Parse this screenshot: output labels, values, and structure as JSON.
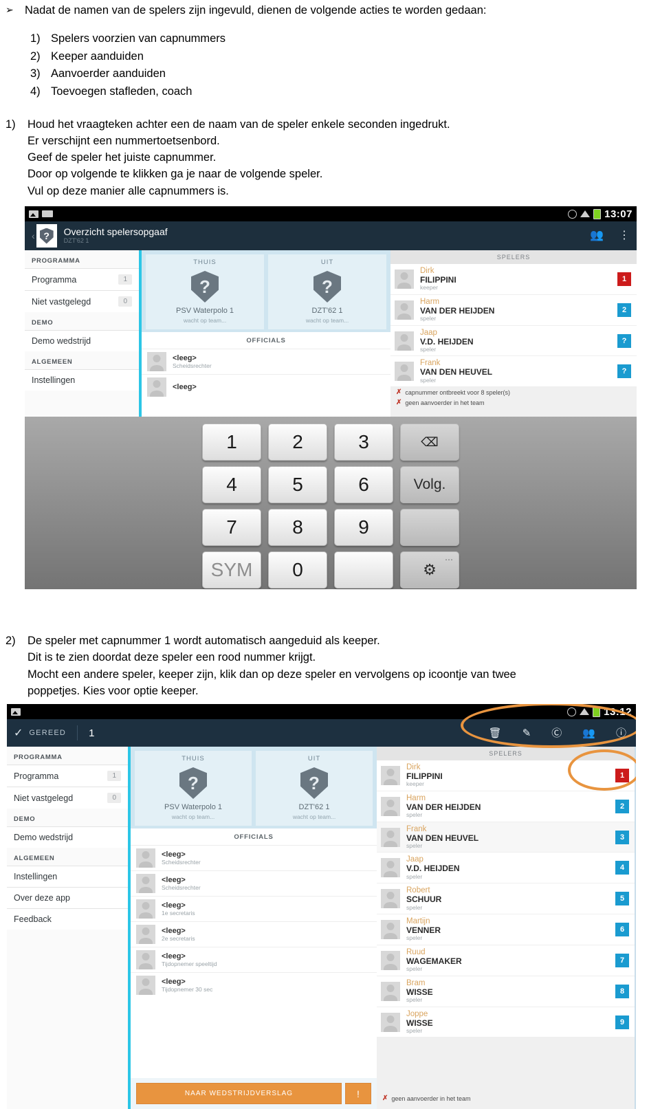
{
  "document": {
    "bullet_marker": "➢",
    "intro": "Nadat de namen van de spelers zijn ingevuld, dienen de volgende acties te worden gedaan:",
    "actions": [
      {
        "num": "1)",
        "text": "Spelers voorzien van capnummers"
      },
      {
        "num": "2)",
        "text": " Keeper aanduiden"
      },
      {
        "num": "3)",
        "text": "Aanvoerder aanduiden"
      },
      {
        "num": "4)",
        "text": "Toevoegen stafleden, coach"
      }
    ],
    "step1": {
      "num": "1)",
      "lines": [
        "Houd het vraagteken achter een de naam van de speler enkele seconden ingedrukt.",
        "Er verschijnt een nummertoetsenbord.",
        "Geef de speler het juiste capnummer.",
        "Door op volgende te klikken ga je naar de volgende speler.",
        "Vul op deze manier alle capnummers is."
      ]
    },
    "step2": {
      "num": "2)",
      "lines": [
        "De speler met capnummer 1 wordt automatisch aangeduid als keeper.",
        "Dit is te zien doordat deze speler een rood nummer krijgt.",
        "Mocht een andere speler, keeper zijn, klik dan op deze speler en vervolgens op icoontje van twee",
        "poppetjes. Kies voor optie keeper."
      ]
    }
  },
  "screenshot1": {
    "statusbar": {
      "time": "13:07",
      "icons": [
        "image-icon",
        "keyboard-icon",
        "alarm-icon",
        "wifi-icon",
        "battery-icon"
      ]
    },
    "appbar": {
      "back": "‹",
      "shield_glyph": "?",
      "title": "Overzicht spelersopgaaf",
      "subtitle": "DZT'62 1",
      "icons": [
        "add-people-icon",
        "overflow-menu-icon"
      ],
      "add_people_glyph": "👥",
      "overflow_glyph": "⋮"
    },
    "nav": {
      "groups": [
        {
          "header": "PROGRAMMA",
          "items": [
            {
              "label": "Programma",
              "badge": "1"
            },
            {
              "label": "Niet vastgelegd",
              "badge": "0"
            }
          ]
        },
        {
          "header": "DEMO",
          "items": [
            {
              "label": "Demo wedstrijd",
              "badge": ""
            }
          ]
        },
        {
          "header": "ALGEMEEN",
          "items": [
            {
              "label": "Instellingen",
              "badge": ""
            }
          ]
        }
      ]
    },
    "teams": [
      {
        "side": "THUIS",
        "shield": "?",
        "name": "PSV Waterpolo 1",
        "status": "wacht op team..."
      },
      {
        "side": "UIT",
        "shield": "?",
        "name": "DZT'62 1",
        "status": "wacht op team..."
      }
    ],
    "officials": {
      "header": "OFFICIALS",
      "rows": [
        {
          "name": "<leeg>",
          "role": "Scheidsrechter"
        },
        {
          "name": "<leeg>",
          "role": ""
        }
      ]
    },
    "players": {
      "header": "SPELERS",
      "rows": [
        {
          "first": "Dirk",
          "last": "FILIPPINI",
          "role": "keeper",
          "cap": "1",
          "cap_color": "red"
        },
        {
          "first": "Harm",
          "last": "VAN DER HEIJDEN",
          "role": "speler",
          "cap": "2",
          "cap_color": "blue"
        },
        {
          "first": "Jaap",
          "last": "V.D. HEIJDEN",
          "role": "speler",
          "cap": "?",
          "cap_color": "blue"
        },
        {
          "first": "Frank",
          "last": "VAN DEN HEUVEL",
          "role": "speler",
          "cap": "?",
          "cap_color": "blue"
        }
      ],
      "errors": [
        "capnummer ontbreekt voor 8 speler(s)",
        "geen aanvoerder in het team"
      ]
    },
    "keyboard": {
      "rows": [
        [
          {
            "label": "1",
            "type": "num"
          },
          {
            "label": "2",
            "type": "num"
          },
          {
            "label": "3",
            "type": "num"
          },
          {
            "label": "⌫",
            "type": "backspace"
          }
        ],
        [
          {
            "label": "4",
            "type": "num"
          },
          {
            "label": "5",
            "type": "num"
          },
          {
            "label": "6",
            "type": "num"
          },
          {
            "label": "Volg.",
            "type": "fn"
          }
        ],
        [
          {
            "label": "7",
            "type": "num"
          },
          {
            "label": "8",
            "type": "num"
          },
          {
            "label": "9",
            "type": "num"
          },
          {
            "label": "",
            "type": "fn"
          }
        ],
        [
          {
            "label": "SYM",
            "type": "dim"
          },
          {
            "label": "0",
            "type": "num"
          },
          {
            "label": "",
            "type": "num"
          },
          {
            "label": "⚙",
            "type": "gear"
          }
        ]
      ]
    }
  },
  "screenshot2": {
    "statusbar": {
      "time": "13:12",
      "icons": [
        "image-icon",
        "alarm-icon",
        "wifi-icon",
        "battery-icon"
      ]
    },
    "gereed_bar": {
      "check_glyph": "✓",
      "label": "GEREED",
      "number": "1",
      "icons": [
        {
          "name": "trash-icon",
          "glyph": "🗑"
        },
        {
          "name": "edit-pen-icon",
          "glyph": "✎"
        },
        {
          "name": "copyright-icon",
          "glyph": "Ⓒ"
        },
        {
          "name": "two-people-icon",
          "glyph": "👥"
        },
        {
          "name": "info-icon",
          "glyph": "ⓘ"
        }
      ]
    },
    "nav": {
      "groups": [
        {
          "header": "PROGRAMMA",
          "items": [
            {
              "label": "Programma",
              "badge": "1"
            },
            {
              "label": "Niet vastgelegd",
              "badge": "0"
            }
          ]
        },
        {
          "header": "DEMO",
          "items": [
            {
              "label": "Demo wedstrijd",
              "badge": ""
            }
          ]
        },
        {
          "header": "ALGEMEEN",
          "items": [
            {
              "label": "Instellingen",
              "badge": ""
            },
            {
              "label": "Over deze app",
              "badge": ""
            },
            {
              "label": "Feedback",
              "badge": ""
            }
          ]
        }
      ]
    },
    "teams": [
      {
        "side": "THUIS",
        "shield": "?",
        "name": "PSV Waterpolo 1",
        "status": "wacht op team..."
      },
      {
        "side": "UIT",
        "shield": "?",
        "name": "DZT'62 1",
        "status": "wacht op team..."
      }
    ],
    "officials": {
      "header": "OFFICIALS",
      "rows": [
        {
          "name": "<leeg>",
          "role": "Scheidsrechter"
        },
        {
          "name": "<leeg>",
          "role": "Scheidsrechter"
        },
        {
          "name": "<leeg>",
          "role": "1e secretaris"
        },
        {
          "name": "<leeg>",
          "role": "2e secretaris"
        },
        {
          "name": "<leeg>",
          "role": "Tijdopnemer speeltijd"
        },
        {
          "name": "<leeg>",
          "role": "Tijdopnemer 30 sec"
        }
      ]
    },
    "report_button": {
      "label": "NAAR WEDSTRIJDVERSLAG",
      "warn_glyph": "!"
    },
    "players": {
      "header": "SPELERS",
      "rows": [
        {
          "first": "Dirk",
          "last": "FILIPPINI",
          "role": "keeper",
          "cap": "1",
          "cap_color": "red"
        },
        {
          "first": "Harm",
          "last": "VAN DER HEIJDEN",
          "role": "speler",
          "cap": "2",
          "cap_color": "blue"
        },
        {
          "first": "Frank",
          "last": "VAN DEN HEUVEL",
          "role": "speler",
          "cap": "3",
          "cap_color": "blue"
        },
        {
          "first": "Jaap",
          "last": "V.D. HEIJDEN",
          "role": "speler",
          "cap": "4",
          "cap_color": "blue"
        },
        {
          "first": "Robert",
          "last": "SCHUUR",
          "role": "speler",
          "cap": "5",
          "cap_color": "blue"
        },
        {
          "first": "Martijn",
          "last": "VENNER",
          "role": "speler",
          "cap": "6",
          "cap_color": "blue"
        },
        {
          "first": "Ruud",
          "last": "WAGEMAKER",
          "role": "speler",
          "cap": "7",
          "cap_color": "blue"
        },
        {
          "first": "Bram",
          "last": "WISSE",
          "role": "speler",
          "cap": "8",
          "cap_color": "blue"
        },
        {
          "first": "Joppe",
          "last": "WISSE",
          "role": "speler",
          "cap": "9",
          "cap_color": "blue"
        }
      ],
      "errors": [
        "geen aanvoerder in het team"
      ]
    },
    "highlights": {
      "toolbar_ellipse": "highlight-toolbar-icons",
      "cap_ellipse": "highlight-keeper-capnumber"
    }
  },
  "colors": {
    "accent_cyan": "#2cc6e6",
    "appbar_dark": "#1d2f3d",
    "highlight_orange": "#e8943f",
    "cap_blue": "#1a9bd0",
    "cap_red": "#cc1b1b",
    "player_first_name": "#d9a45f"
  }
}
